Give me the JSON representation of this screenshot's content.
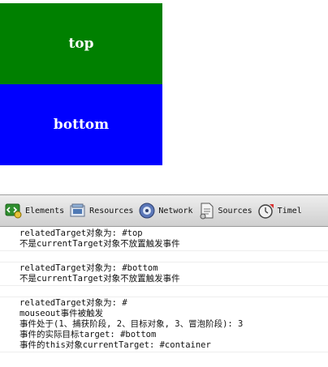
{
  "page": {
    "box_top_label": "top",
    "box_bottom_label": "bottom",
    "box_top_color": "#008000",
    "box_bottom_color": "#0000ff"
  },
  "devtools": {
    "tabs": [
      {
        "label": "Elements",
        "icon": "elements-icon"
      },
      {
        "label": "Resources",
        "icon": "resources-icon"
      },
      {
        "label": "Network",
        "icon": "network-icon"
      },
      {
        "label": "Sources",
        "icon": "sources-icon"
      },
      {
        "label": "Timel",
        "icon": "timeline-icon"
      }
    ],
    "console": {
      "line1": "relatedTarget对象为: #top",
      "line2": "不是currentTarget对象不放置触发事件",
      "line3": "relatedTarget对象为: #bottom",
      "line4": "不是currentTarget对象不放置触发事件",
      "line5": "relatedTarget对象为: #",
      "line6": "mouseout事件被触发",
      "line7": "事件处于(1、捕获阶段, 2、目标对象, 3、冒泡阶段): 3",
      "line8": "事件的实际目标target: #bottom",
      "line9": "事件的this对象currentTarget: #container"
    }
  }
}
